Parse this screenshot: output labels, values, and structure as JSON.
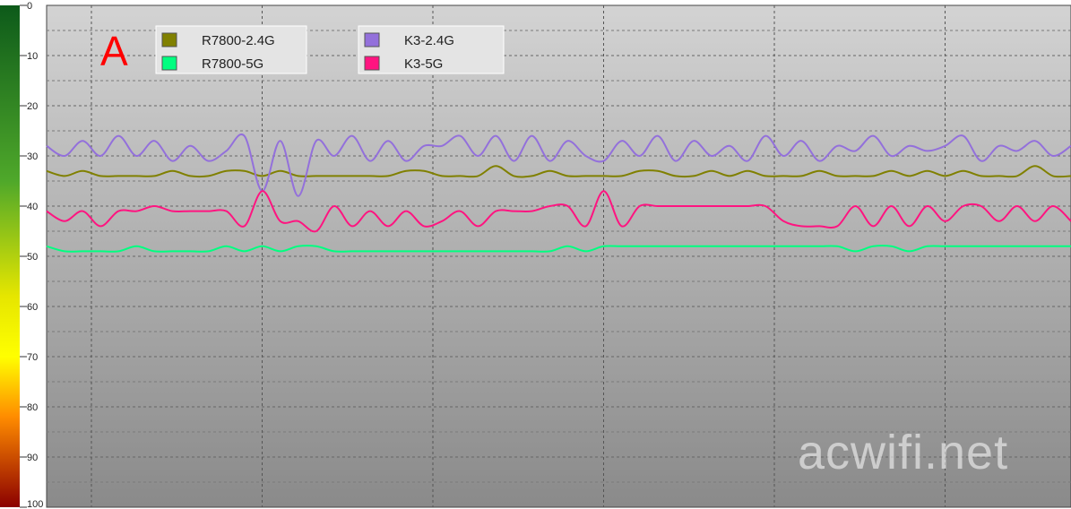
{
  "chart_data": {
    "type": "line",
    "title": "",
    "xlabel": "",
    "ylabel": "",
    "ylim": [
      0,
      100
    ],
    "y_inverted": true,
    "y_ticks": [
      0,
      10,
      20,
      30,
      40,
      50,
      60,
      70,
      80,
      90,
      100
    ],
    "y_tick_labels": [
      "0",
      "10",
      "20",
      "30",
      "40",
      "50",
      "60",
      "70",
      "80",
      "90",
      "100"
    ],
    "x_points": 58,
    "grid": "on",
    "legend_position": "top-left",
    "background": "grey-gradient",
    "series": [
      {
        "name": "R7800-2.4G",
        "color": "#808000",
        "values": [
          33,
          34,
          33,
          34,
          34,
          34,
          34,
          33,
          34,
          34,
          33,
          33,
          34,
          33,
          34,
          34,
          34,
          34,
          34,
          34,
          33,
          33,
          34,
          34,
          34,
          32,
          34,
          34,
          33,
          34,
          34,
          34,
          34,
          33,
          33,
          34,
          34,
          33,
          34,
          33,
          34,
          34,
          34,
          33,
          34,
          34,
          34,
          33,
          34,
          33,
          34,
          33,
          34,
          34,
          34,
          32,
          34,
          34
        ]
      },
      {
        "name": "R7800-5G",
        "color": "#00ff80",
        "values": [
          48,
          49,
          49,
          49,
          49,
          48,
          49,
          49,
          49,
          49,
          48,
          49,
          48,
          49,
          48,
          48,
          49,
          49,
          49,
          49,
          49,
          49,
          49,
          49,
          49,
          49,
          49,
          49,
          49,
          48,
          49,
          48,
          48,
          48,
          48,
          48,
          48,
          48,
          48,
          48,
          48,
          48,
          48,
          48,
          48,
          49,
          48,
          48,
          49,
          48,
          48,
          48,
          48,
          48,
          48,
          48,
          48,
          48
        ]
      },
      {
        "name": "K3-2.4G",
        "color": "#9370db",
        "values": [
          28,
          30,
          27,
          30,
          26,
          30,
          27,
          31,
          28,
          31,
          29,
          26,
          37,
          27,
          38,
          27,
          30,
          26,
          31,
          27,
          31,
          28,
          28,
          26,
          30,
          26,
          31,
          26,
          31,
          27,
          30,
          31,
          27,
          30,
          26,
          31,
          27,
          30,
          28,
          31,
          26,
          30,
          27,
          31,
          28,
          29,
          26,
          30,
          28,
          29,
          28,
          26,
          31,
          28,
          29,
          27,
          30,
          28
        ]
      },
      {
        "name": "K3-5G",
        "color": "#ff1480",
        "values": [
          41,
          43,
          41,
          44,
          41,
          41,
          40,
          41,
          41,
          41,
          41,
          44,
          37,
          43,
          43,
          45,
          40,
          44,
          41,
          44,
          41,
          44,
          43,
          41,
          44,
          41,
          41,
          41,
          40,
          40,
          44,
          37,
          44,
          40,
          40,
          40,
          40,
          40,
          40,
          40,
          40,
          43,
          44,
          44,
          44,
          40,
          44,
          40,
          44,
          40,
          43,
          40,
          40,
          43,
          40,
          43,
          40,
          43
        ]
      }
    ]
  },
  "annotations": {
    "marker_letter": "A",
    "watermark": "acwifi.net"
  },
  "colors": {
    "marker_letter": "#ff0000",
    "scale_top": "#1a6b1a",
    "scale_mid": "#ffff00",
    "scale_bottom": "#aa0000"
  }
}
